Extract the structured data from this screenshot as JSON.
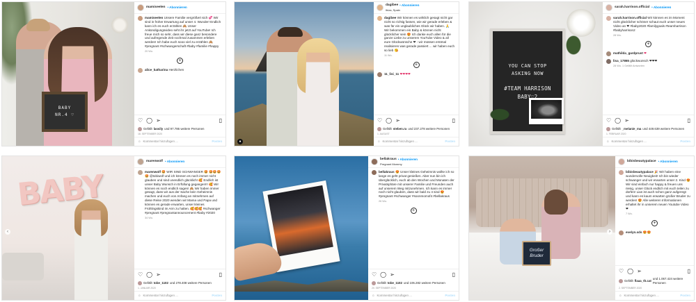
{
  "ui": {
    "follow_label": "• Abonnieren",
    "add_comment": "Kommentar hinzufügen ...",
    "post_label": "Posten"
  },
  "posts": [
    {
      "username": "mamiseelen",
      "caption_user": "mamiseelen",
      "caption": "Unsere Familie vergrößert sich 💞 Wir sind in froher Erwartung auf unser 4. Wunder! Endlich kann ich es euch erzählen 🙈 Unser Ankündigungsvideo seht ihr jetzt auf YouTube! Ich freue mich so sehr, dass wir diese ganz besondere und aufregende Zeit nochmal zusammen erleben werden! Ich habe euch sooo viel zu erzählen 🙈 #pregnant #schwangerschaft #baby #familie #happy",
      "time": "20 Wo.",
      "comment_user": "alice_katharina",
      "comment": "Herzlichen",
      "likes_prefix": "Gefällt",
      "likes_user": "lassily",
      "likes_rest": "und 97.786 weitere Personen",
      "date": "18. SEPTEMBER 2020",
      "sign_text": "BABY NR.4 ♡"
    },
    {
      "username": "dagibee",
      "subtitle": "Ibiza, Spain",
      "caption_user": "dagibee",
      "caption": "Wir können es wirklich gesagt nicht gar nicht so richtig fassen, wie wir gerade erleben & was für ein unglaubliches Glück wir haben. 🙏 Wir bekommen ein Baby & können nicht glücklicher sein 😍 Ich danke euch allen für die ganze Liebe zu unserem YouTube Video & all eure Glückwünsche ❤ - wir müssen erstmal realisieren was gerade passiert ... wir haben euch so lieb 😘",
      "time": "11 Wo.",
      "comment_user": "11_lisi_11",
      "comment": "❤❤❤❤",
      "likes_prefix": "Gefällt",
      "likes_user": "steben.ra",
      "likes_rest": "und 237.278 weitere Personen",
      "date": "1. AUGUST"
    },
    {
      "username": "sarah.harrison.official",
      "caption_user": "sarah.harrison.official",
      "caption": "Wir können es im Moment nicht glücklicher schöner schaut euch unser neues Video an ❤ #baby2020 #familygoals #teamharrison #babyharrison2",
      "time": "28 Wo.",
      "comment_user": "mathilda_gardprust",
      "comment": "❤",
      "comment2_user": "lisa_17865",
      "comment2": "glückwunsch ❤❤❤",
      "comment2_time": "28 Wo.   1 Gefällt    Antworten",
      "likes_prefix": "Gefällt",
      "likes_user": "_melanie_ma",
      "likes_rest": "und 449.639 weitere Personen",
      "date": "1. FEBRUAR 2020",
      "board_line1": "YOU CAN STOP",
      "board_line2": "ASKING NOW",
      "board_line3": "#TEAM HARRISON",
      "board_line4": "BABY♡2"
    },
    {
      "username": "marenwolf",
      "caption_user": "marenwolf",
      "caption": "🤩 WIR SIND SCHWANGER 🤩 🤩🤩🤩🤩 @tobiwolf und ich können es noch immer nicht glauben und sind unendlich glücklich! 🥰 Endlich ist unser Baby Wunsch in Erfüllung gegangen!!! 🥰 Wir können es noch endlich sagen! 🙈 Wir haben immer gesagt, dass wir aus der Sache kein Geheimnis machen und euch von Anfang an mitnehmen auf diese Reise 2020 wenden wir Mama und Papa und können es gerade erwarten, unser kleines Frühlingskind im Arm zu halten. 🥰🥰🥰 #schwanger #pregnant #pregnantannouncement #baby #2020",
      "time": "34 Wo.",
      "likes_prefix": "Gefällt",
      "likes_user": "tobe_1102",
      "likes_rest": "und 278.408 weitere Personen",
      "date": "1. JANUAR 2020",
      "balloon_text": "BABY"
    },
    {
      "username": "bellakraus",
      "subtitle": "Pregnant Mommy",
      "caption_user": "bellakraus",
      "caption": "😍 Unser kleines Geheimnis wollte ich so lange es geht privat genießen. Aber nun bin ich überglücklich, euch ab den Wochen und Monaten der Privatsphäre mit unserer Familie und Freunden auch auf unserem Weg mitzunehmen. Ich kann es immer noch nicht glauben, dass wir bald zu 4 sind 😍 #pregnant #schwanger #soonmomof4 #bellakraus",
      "time": "26 Wo.",
      "likes_prefix": "Gefällt",
      "likes_user": "tobe_1102",
      "likes_rest": "und 106.282 weitere Personen",
      "date": "20. SEPTEMBER 2020"
    },
    {
      "username": "bibisbeautypalace",
      "caption_user": "bibisbeautypalace",
      "caption": "🎉 Wir haben eine wundervolle Neuigkeit! Ich bin wieder schwanger und wir erwarten unser 2. Kind 😍 Wir sind einfach nur happy & freuen uns riesig, unser Glück endlich mit euch teilen zu dürfen! Lian ist auch schon ganz aufgeregt und kann es kaum erwarten großer Bruder zu werden! 😍 Alle weiteren Informationen erhaltet ihr in unserem neuen Youtube Video ❤",
      "time": "7 Wo.",
      "comment_user": "evelyn.sds",
      "comment": "😍😍",
      "likes_prefix": "Gefällt",
      "likes_user": "flaaa_th.cat",
      "likes_rest": "und 1.067.424 weitere Personen",
      "date": "2. SEPTEMBER 2020",
      "sign_text": "Großer Bruder"
    }
  ]
}
